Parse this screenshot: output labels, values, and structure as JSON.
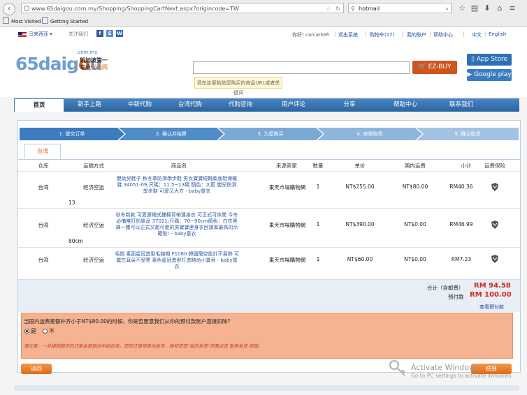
{
  "browser": {
    "url": "www.65daigou.com.my/Shopping/ShoppingCartNext.aspx?origincode=TW",
    "search_value": "hotmail",
    "bookmarks": [
      "Most Visited",
      "Getting Started"
    ]
  },
  "topbar": {
    "region": "马来西亚",
    "follow": "关注我们",
    "greeting": "你好! carcarkeh",
    "logout": "退出系统",
    "cart": "购物车(17)",
    "account": "我的账户",
    "help": "帮助中心",
    "lang_zh": "中文",
    "lang_en": "English"
  },
  "header": {
    "logo": "65daig",
    "logo_o": "o",
    "logo_u": "u",
    "logo_domain": ".com.my",
    "tagline1": "新加坡第一",
    "tagline2_a": "专业",
    "tagline2_b": "代购网",
    "ezbuy": "EZ-BUY",
    "tip": "请在这里粘贴您购买的商品URL或者关键词",
    "appstore": "App Store",
    "googleplay": "Google play"
  },
  "nav": [
    "首页",
    "新手上路",
    "中新代购",
    "台湾代购",
    "代购咨询",
    "用户评论",
    "分享",
    "帮助中心",
    "联系我们"
  ],
  "steps": [
    "1. 提交订单",
    "2. 确认并结算",
    "3. 为您购买",
    "4. 安排取货",
    "5. 确认收货"
  ],
  "tab": "台湾",
  "table": {
    "headers": [
      "仓库",
      "运输方式",
      "商品名",
      "来源商家",
      "数量",
      "单价",
      "国内运费",
      "小计",
      "运费保险"
    ],
    "rows": [
      {
        "warehouse": "台湾",
        "shipping": "经济空运",
        "product": "嬰幼兒鞋子 秋冬季防滑學步鞋 男女寶寶短靴軟底鞋保暖鞋 34051-09;尺碼：11.5~13碼 顏色：大藍 嬰兒防滑學步鞋 可愛又大方 - baby童衣",
        "merchant": "東天市場購物網",
        "qty": "1",
        "price": "NT$255.00",
        "domestic": "NT$80.00",
        "subtotal": "RM40.36",
        "extra": "13"
      },
      {
        "warehouse": "台湾",
        "shipping": "经济空运",
        "product": "秋冬新款 可愛連帽式鋪棉背帶連身衣 可正式可休閒 今冬必備唯打扮單品 37021;尺碼：70~90cm顏色：白衣黑褲一體可以正式又超可愛的男寶寶連身衣回頭率最高的示範啦! - baby童衣",
        "merchant": "東天市場購物網",
        "qty": "1",
        "price": "NT$390.00",
        "domestic": "NT$0.00",
        "subtotal": "RM46.99",
        "extra": "80cm"
      },
      {
        "warehouse": "台湾",
        "shipping": "经济空运",
        "product": "毛帽 素面星冠造型毛線帽 F1060 韓國簡空設計不易熱 可露在耳朵不受寒 素色星冠造型打造時尚小寶貝 - baby童衣",
        "merchant": "東天市場購物網",
        "qty": "1",
        "price": "NT$60.00",
        "domestic": "NT$0.00",
        "subtotal": "RM7.23",
        "extra": ""
      }
    ]
  },
  "totals": {
    "total_label": "合计（含邮费）",
    "total_value": "RM 94.58",
    "prepay_label": "预付款",
    "prepay_value": "RM 100.00",
    "view_tax": "查看预付款"
  },
  "notice": {
    "question": "当国内运费差额补齐小于NT$80.00的时候，你是否愿意我们从你的预付款账户直接扣除?",
    "yes": "是",
    "no": "不",
    "warning": "请注意：一旦相同图次的订单全部到达中国仓库，您的订单将自动发货，除非您在\"我的发货\"页面点击 暂停发货 按钮。"
  },
  "buttons": {
    "back": "返回",
    "checkout": "结算"
  },
  "watermark": {
    "line1": "Activate Windows",
    "line2": "Go to PC settings to activate Windows."
  },
  "colors": {
    "nav_blue": "#3a74b2",
    "accent_orange": "#de6a14",
    "price_red": "#d42a1a",
    "notice_bg": "#f5b392"
  }
}
